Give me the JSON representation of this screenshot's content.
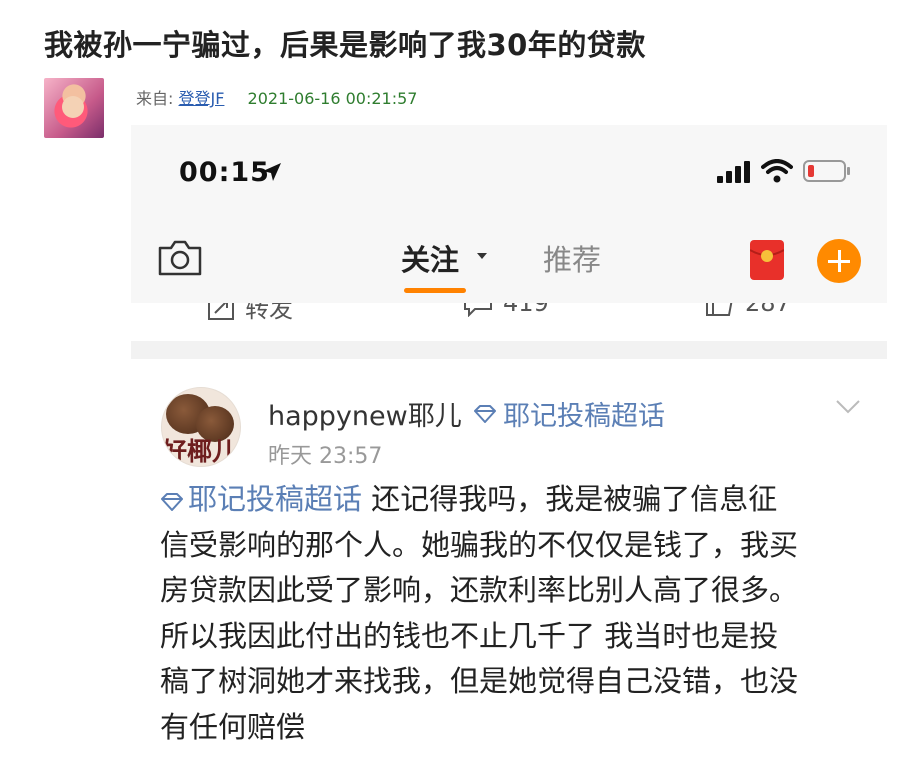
{
  "post": {
    "title": "我被孙一宁骗过，后果是影响了我30年的贷款",
    "from_label": "来自:",
    "author": "登登JF",
    "timestamp": "2021-06-16 00:21:57"
  },
  "phone": {
    "status_bar": {
      "time": "00:15"
    },
    "nav": {
      "tab_follow": "关注",
      "tab_recommend": "推荐"
    },
    "actions": {
      "repost": "转发",
      "comments": "419",
      "likes": "287"
    },
    "card": {
      "avatar_text": "好椰儿",
      "username": "happynew耶儿",
      "supertopic": "耶记投稿超话",
      "time": "昨天 23:57",
      "body_topic": "耶记投稿超话",
      "body_lines": [
        " 还记得我吗，我是被骗了信息征",
        "信受影响的那个人。她骗我的不仅仅是钱了，我买",
        "房贷款因此受了影响，还款利率比别人高了很多。",
        "所以我因此付出的钱也不止几千了 我当时也是投",
        "稿了树洞她才来找我，但是她觉得自己没错，也没",
        "有任何赔偿"
      ]
    },
    "icons": [
      "location-icon",
      "signal-icon",
      "wifi-icon",
      "battery-icon",
      "camera-icon",
      "redpacket-icon",
      "add-icon",
      "repost-icon",
      "comment-icon",
      "like-icon",
      "supertopic-icon",
      "chevron-down-icon"
    ],
    "colors": {
      "accent": "#ff8200",
      "link": "#5b7fb5",
      "battery_low": "#e53935"
    }
  }
}
